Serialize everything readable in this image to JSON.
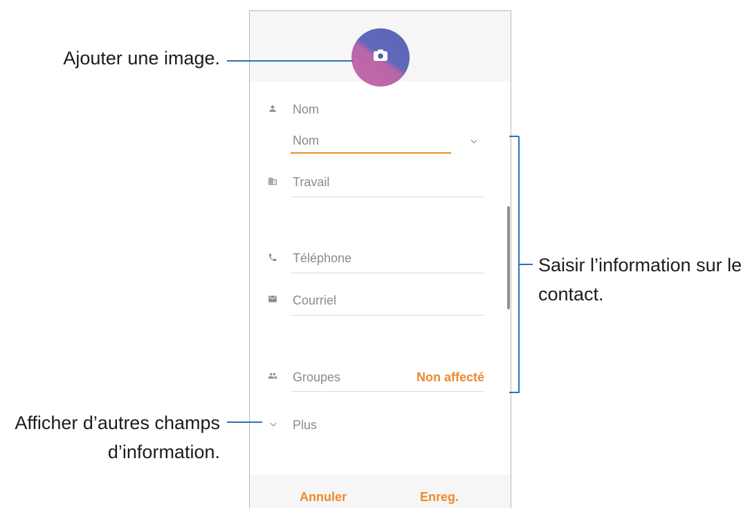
{
  "callouts": {
    "add_image": "Ajouter une image.",
    "enter_contact_info": [
      "Saisir l’information sur le",
      "contact."
    ],
    "show_more_fields": [
      "Afficher d’autres champs",
      "d’information."
    ]
  },
  "contact_form": {
    "avatar": {
      "icon": "camera-icon"
    },
    "name_section": {
      "icon": "person-icon",
      "label": "Nom"
    },
    "name_field": {
      "placeholder": "Nom",
      "expand_icon": "chevron-down-icon"
    },
    "work_field": {
      "icon": "building-icon",
      "placeholder": "Travail"
    },
    "phone_field": {
      "icon": "phone-icon",
      "placeholder": "Téléphone"
    },
    "email_field": {
      "icon": "envelope-icon",
      "placeholder": "Courriel"
    },
    "groups": {
      "icon": "groups-icon",
      "label": "Groupes",
      "value": "Non affecté"
    },
    "more": {
      "icon": "chevron-down-icon",
      "label": "Plus"
    }
  },
  "actions": {
    "cancel": "Annuler",
    "save": "Enreg."
  },
  "colors": {
    "accent": "#ec8a2c",
    "callout_line": "#2b70b1",
    "field_text": "#8a8a8a",
    "avatar_top": "#5a66b9",
    "avatar_bottom": "#c968a9"
  }
}
